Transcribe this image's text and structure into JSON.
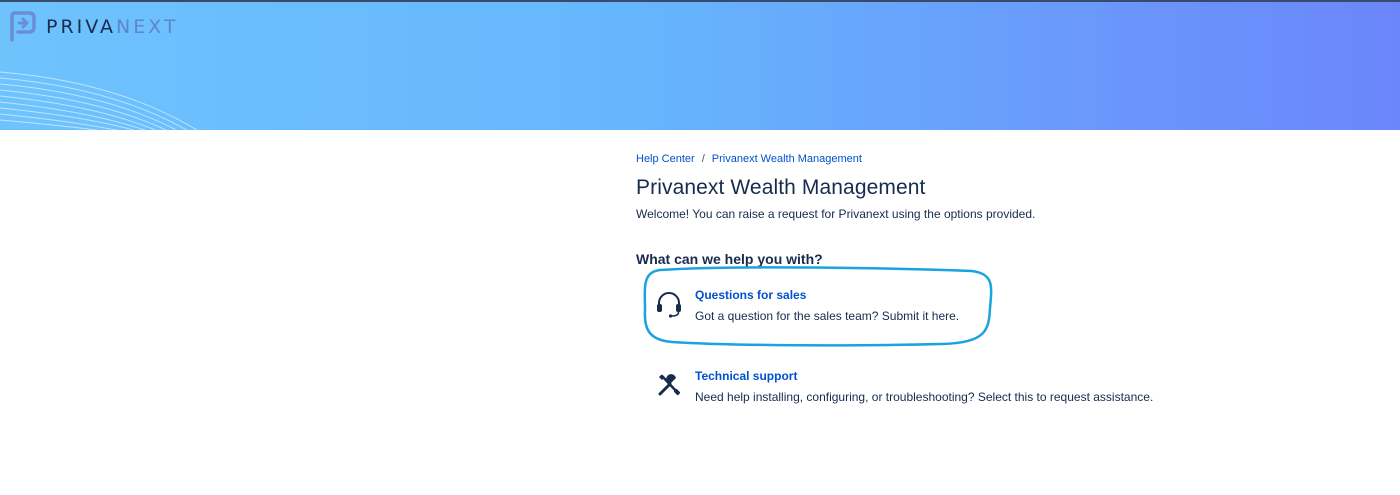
{
  "brand": {
    "name_part1": "PRIVA",
    "name_part2": "NEXT",
    "banner_colors": [
      "#6ec3fd",
      "#6b86fb"
    ],
    "logo_color": "#6a8ed6"
  },
  "breadcrumb": {
    "items": [
      "Help Center",
      "Privanext Wealth Management"
    ],
    "separator": "/"
  },
  "page": {
    "title": "Privanext Wealth Management",
    "welcome": "Welcome! You can raise a request for Privanext using the options provided."
  },
  "help": {
    "heading": "What can we help you with?",
    "options": [
      {
        "title": "Questions for sales",
        "description": "Got a question for the sales team? Submit it here.",
        "icon": "headset-icon",
        "highlighted": true
      },
      {
        "title": "Technical support",
        "description": "Need help installing, configuring, or troubleshooting? Select this to request assistance.",
        "icon": "tools-icon",
        "highlighted": false
      }
    ]
  },
  "colors": {
    "link": "#0052cc",
    "text": "#172b4d",
    "highlight_ring": "#1aa3e0"
  }
}
